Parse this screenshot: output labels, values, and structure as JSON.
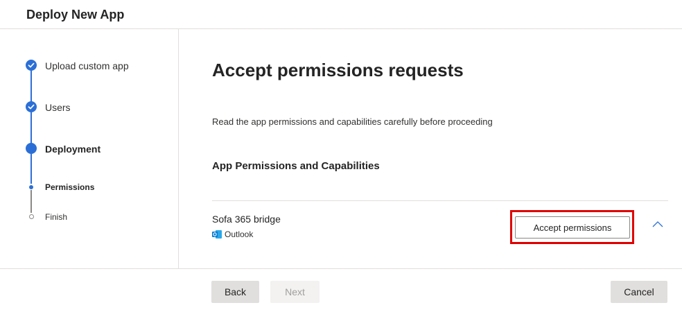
{
  "header": {
    "title": "Deploy New App"
  },
  "steps": [
    {
      "label": "Upload custom app",
      "state": "done"
    },
    {
      "label": "Users",
      "state": "done"
    },
    {
      "label": "Deployment",
      "state": "current"
    },
    {
      "label": "Permissions",
      "state": "current-substep"
    },
    {
      "label": "Finish",
      "state": "pending-substep"
    }
  ],
  "main": {
    "title": "Accept permissions requests",
    "description": "Read the app permissions and capabilities carefully before proceeding",
    "section_title": "App Permissions and Capabilities",
    "app": {
      "name": "Sofa 365 bridge",
      "host": "Outlook",
      "host_icon": "outlook-icon",
      "accept_label": "Accept permissions",
      "expanded": true
    }
  },
  "footer": {
    "back_label": "Back",
    "next_label": "Next",
    "cancel_label": "Cancel"
  },
  "colors": {
    "accent": "#2b6fd6",
    "highlight": "#e00000",
    "outlook": "#0078d4"
  }
}
